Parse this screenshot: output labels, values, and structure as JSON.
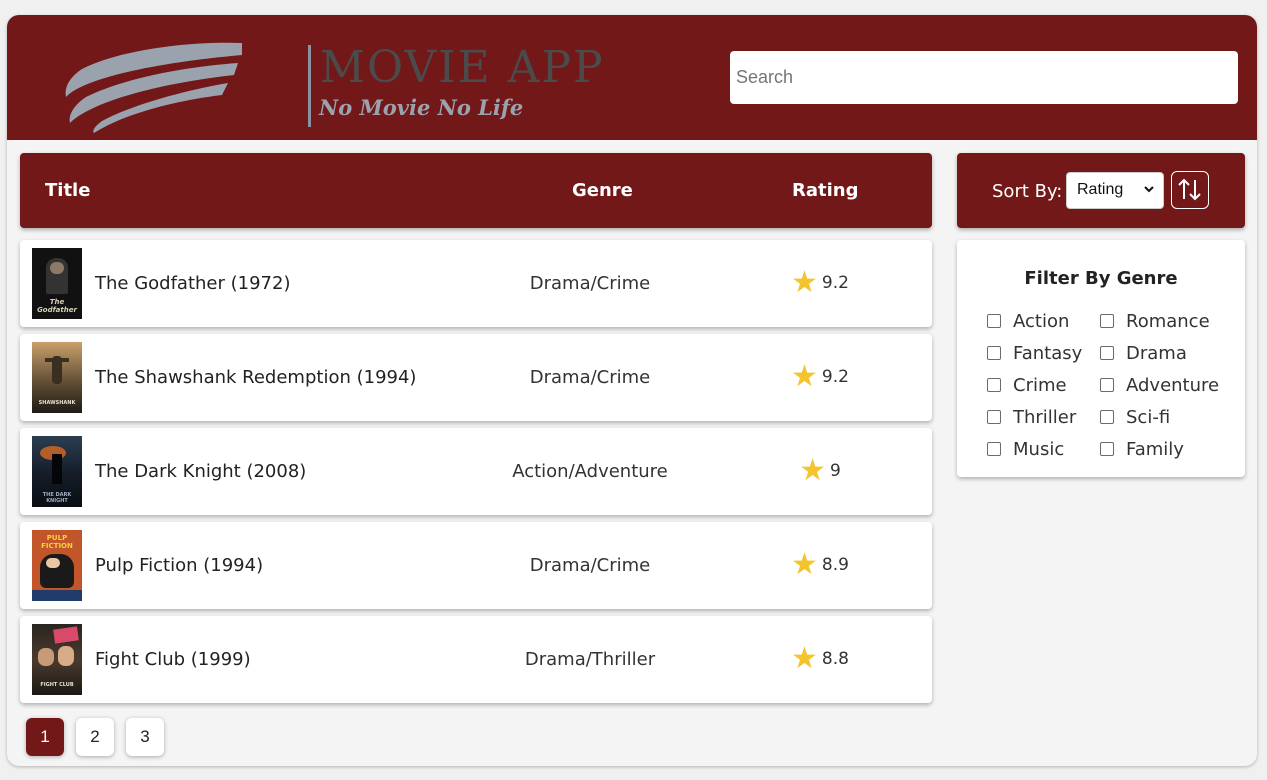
{
  "app": {
    "logo_title": "MOVIE APP",
    "logo_tagline": "No Movie No Life",
    "brand_color": "#721819",
    "star_color": "#f4c430"
  },
  "search": {
    "placeholder": "Search",
    "value": ""
  },
  "table": {
    "headers": {
      "title": "Title",
      "genre": "Genre",
      "rating": "Rating"
    },
    "rows": [
      {
        "title": "The Godfather (1972)",
        "genre": "Drama/Crime",
        "rating": "9.2",
        "poster_icon": "godfather-poster"
      },
      {
        "title": "The Shawshank Redemption (1994)",
        "genre": "Drama/Crime",
        "rating": "9.2",
        "poster_icon": "shawshank-poster"
      },
      {
        "title": "The Dark Knight (2008)",
        "genre": "Action/Adventure",
        "rating": "9",
        "poster_icon": "dark-knight-poster"
      },
      {
        "title": "Pulp Fiction (1994)",
        "genre": "Drama/Crime",
        "rating": "8.9",
        "poster_icon": "pulp-fiction-poster"
      },
      {
        "title": "Fight Club (1999)",
        "genre": "Drama/Thriller",
        "rating": "8.8",
        "poster_icon": "fight-club-poster"
      }
    ]
  },
  "sort": {
    "label": "Sort By:",
    "selected": "Rating",
    "toggle_icon": "sort-arrows-icon"
  },
  "filter": {
    "title": "Filter By Genre",
    "genres": [
      {
        "label": "Action",
        "checked": false
      },
      {
        "label": "Romance",
        "checked": false
      },
      {
        "label": "Fantasy",
        "checked": false
      },
      {
        "label": "Drama",
        "checked": false
      },
      {
        "label": "Crime",
        "checked": false
      },
      {
        "label": "Adventure",
        "checked": false
      },
      {
        "label": "Thriller",
        "checked": false
      },
      {
        "label": "Sci-fi",
        "checked": false
      },
      {
        "label": "Music",
        "checked": false
      },
      {
        "label": "Family",
        "checked": false
      }
    ]
  },
  "pagination": {
    "pages": [
      "1",
      "2",
      "3"
    ],
    "current": "1"
  }
}
